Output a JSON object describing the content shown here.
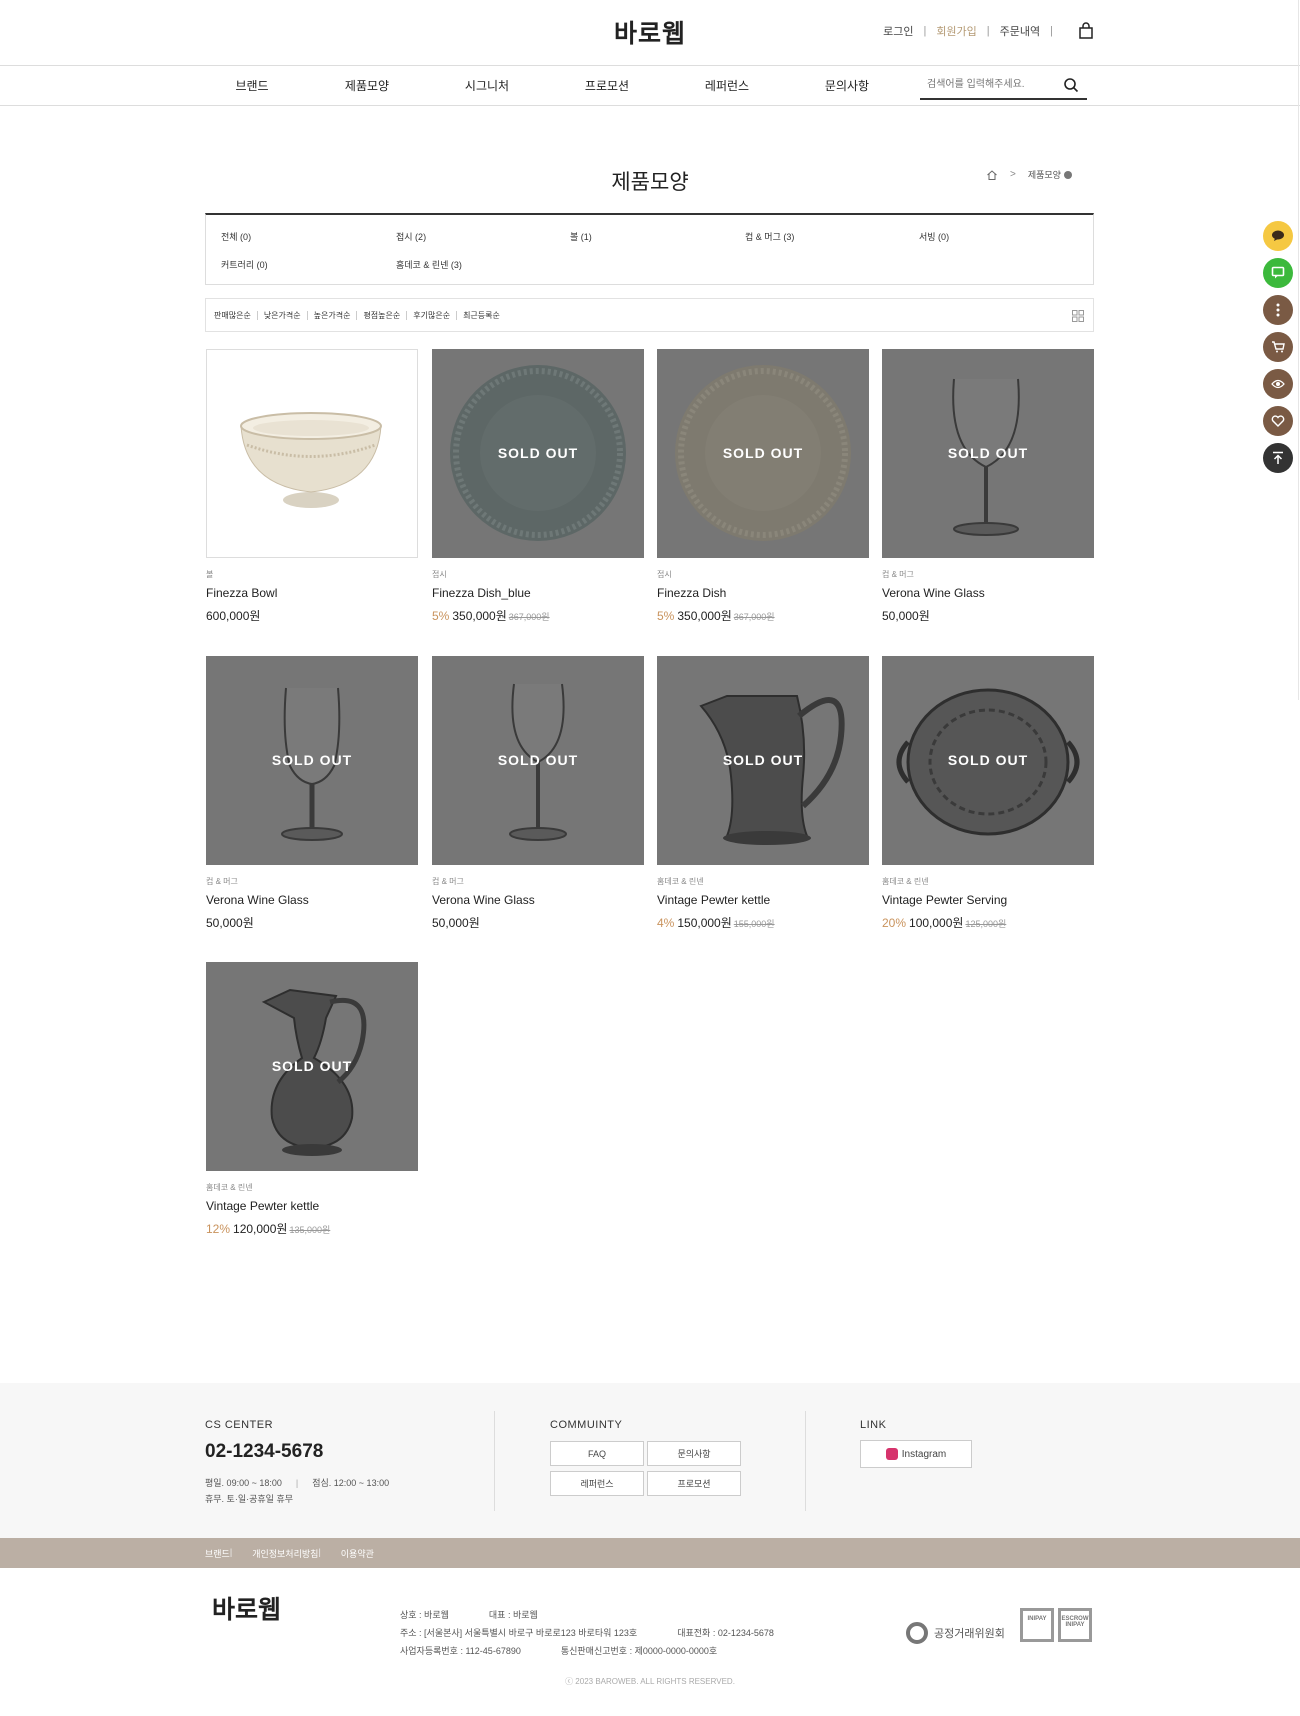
{
  "header": {
    "logo": "바로웹",
    "util": {
      "login": "로그인",
      "join": "회원가입",
      "orders": "주문내역",
      "sep": "|"
    },
    "nav": [
      "브랜드",
      "제품모양",
      "시그니처",
      "프로모션",
      "레퍼런스",
      "문의사항"
    ],
    "search_placeholder": "검색어를 입력해주세요."
  },
  "page": {
    "title": "제품모양",
    "breadcrumb": {
      "current": "제품모양",
      "sep": ">"
    }
  },
  "categories": [
    "전체 (0)",
    "접시 (2)",
    "볼 (1)",
    "컵 & 머그 (3)",
    "서빙 (0)",
    "커트러리 (0)",
    "홈데코 & 린넨 (3)"
  ],
  "sort_options": [
    "판매많은순",
    "낮은가격순",
    "높은가격순",
    "평점높은순",
    "후기많은순",
    "최근등록순"
  ],
  "sold_out_label": "SOLD OUT",
  "products": [
    {
      "category": "볼",
      "name": "Finezza Bowl",
      "discount": "",
      "price": "600,000원",
      "original": "",
      "sold_out": false,
      "image": "bowl"
    },
    {
      "category": "접시",
      "name": "Finezza Dish_blue",
      "discount": "5%",
      "price": "350,000원",
      "original": "367,000원",
      "sold_out": true,
      "image": "plate-blue"
    },
    {
      "category": "접시",
      "name": "Finezza Dish",
      "discount": "5%",
      "price": "350,000원",
      "original": "367,000원",
      "sold_out": true,
      "image": "plate-cream"
    },
    {
      "category": "컵 & 머그",
      "name": "Verona Wine Glass",
      "discount": "",
      "price": "50,000원",
      "original": "",
      "sold_out": true,
      "image": "wine-glass-wide"
    },
    {
      "category": "컵 & 머그",
      "name": "Verona Wine Glass",
      "discount": "",
      "price": "50,000원",
      "original": "",
      "sold_out": true,
      "image": "wine-glass-tulip"
    },
    {
      "category": "컵 & 머그",
      "name": "Verona Wine Glass",
      "discount": "",
      "price": "50,000원",
      "original": "",
      "sold_out": true,
      "image": "wine-glass-tall"
    },
    {
      "category": "홈데코 & 린넨",
      "name": "Vintage Pewter kettle",
      "discount": "4%",
      "price": "150,000원",
      "original": "155,000원",
      "sold_out": true,
      "image": "pewter-pitcher"
    },
    {
      "category": "홈데코 & 린넨",
      "name": "Vintage Pewter Serving",
      "discount": "20%",
      "price": "100,000원",
      "original": "125,000원",
      "sold_out": true,
      "image": "pewter-tray"
    },
    {
      "category": "홈데코 & 린넨",
      "name": "Vintage Pewter kettle",
      "discount": "12%",
      "price": "120,000원",
      "original": "135,000원",
      "sold_out": true,
      "image": "pewter-ewer"
    }
  ],
  "quick_menu": [
    {
      "icon": "talk-icon",
      "color": "#f5c842"
    },
    {
      "icon": "chat-icon",
      "color": "#3cb93c"
    },
    {
      "icon": "more-icon",
      "color": "#7a5a44"
    },
    {
      "icon": "cart-icon",
      "color": "#7a5a44"
    },
    {
      "icon": "eye-icon",
      "color": "#7a5a44"
    },
    {
      "icon": "heart-icon",
      "color": "#7a5a44"
    },
    {
      "icon": "to-top-icon",
      "color": "#333333"
    }
  ],
  "footer": {
    "cs_title": "CS CENTER",
    "tel": "02-1234-5678",
    "hours_1": "평일. 09:00 ~ 18:00",
    "hours_sep": "|",
    "hours_lunch": "점심. 12:00 ~ 13:00",
    "hours_2": "휴무. 토·일·공휴일 휴무",
    "community_title": "COMMUINTY",
    "community_buttons": [
      "FAQ",
      "문의사항",
      "레퍼런스",
      "프로모션"
    ],
    "link_title": "LINK",
    "instagram": "Instagram",
    "bar_links": [
      "브랜드",
      "개인정보처리방침",
      "이용약관"
    ],
    "bar_sep": "|",
    "logo": "바로웹",
    "company": "상호 : 바로웹",
    "ceo": "대표 : 바로웹",
    "address": "주소 : [서울본사] 서울특별시 바로구 바로로123 바로타워 123호",
    "phone": "대표전화 : 02-1234-5678",
    "biz_no": "사업자등록번호 : 112-45-67890",
    "mail_order": "통신판매신고번호 : 제0000-0000-0000호",
    "copyright": "ⓒ 2023 BAROWEB. ALL RIGHTS RESERVED.",
    "ftc": "공정거래위원회",
    "inipay": "INIPAY",
    "escrow": "ESCROW INIPAY"
  },
  "colors": {
    "accent": "#b49a74",
    "discount": "#c9935d",
    "footer_bar": "#bbafa4",
    "soldout_overlay": "#767676"
  }
}
